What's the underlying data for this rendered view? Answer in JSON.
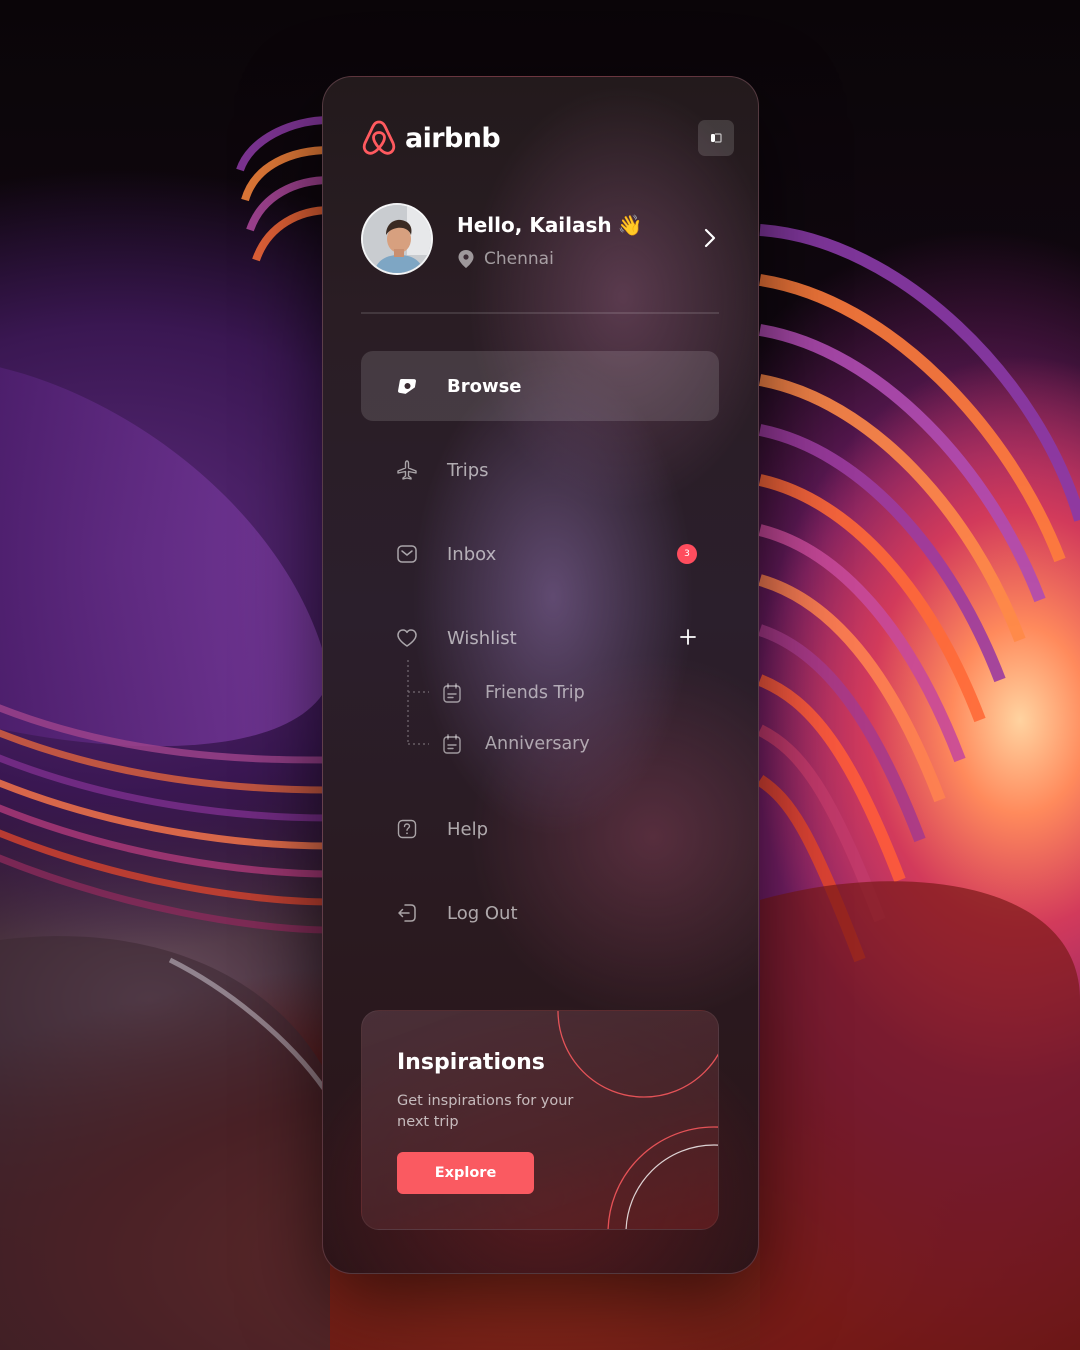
{
  "brand": {
    "name": "airbnb",
    "accent_color": "#FF5A5F",
    "logo_icon": "airbnb-belo-icon"
  },
  "header": {
    "toggle_icon": "sidebar-toggle-icon"
  },
  "profile": {
    "greeting": "Hello, Kailash",
    "greeting_emoji": "👋",
    "location": "Chennai",
    "location_icon": "location-pin-icon",
    "chevron_icon": "chevron-right-icon"
  },
  "nav": {
    "items": [
      {
        "label": "Browse",
        "icon": "compass-icon",
        "active": true
      },
      {
        "label": "Trips",
        "icon": "airplane-icon"
      },
      {
        "label": "Inbox",
        "icon": "inbox-icon",
        "badge": "3"
      },
      {
        "label": "Wishlist",
        "icon": "heart-icon",
        "action_icon": "plus-icon"
      },
      {
        "label": "Help",
        "icon": "help-icon"
      },
      {
        "label": "Log Out",
        "icon": "logout-icon"
      }
    ],
    "wishlist_items": [
      {
        "label": "Friends Trip",
        "icon": "calendar-icon"
      },
      {
        "label": "Anniversary",
        "icon": "calendar-icon"
      }
    ],
    "badge_color": "#FF4D5E"
  },
  "card": {
    "title": "Inspirations",
    "text": "Get inspirations for your next trip",
    "button_label": "Explore",
    "button_color": "#FA5A61"
  }
}
